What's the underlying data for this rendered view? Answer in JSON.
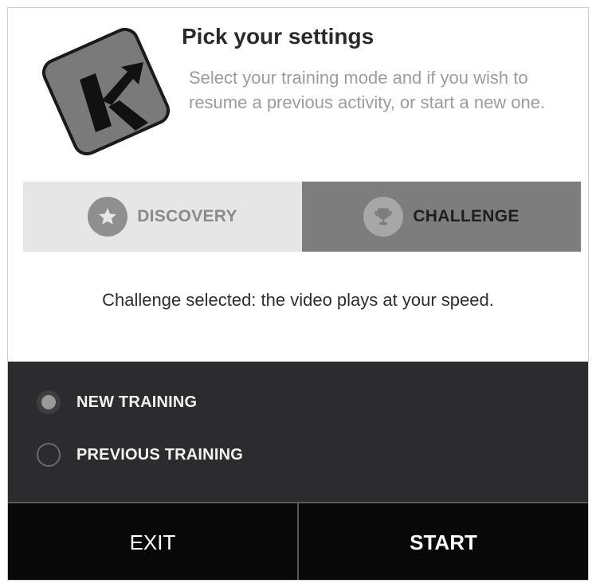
{
  "header": {
    "logo_letter": "K",
    "title": "Pick your settings",
    "subtitle": "Select your training mode and if you wish to resume a previous activity, or start a new one."
  },
  "mode_tabs": [
    {
      "label": "DISCOVERY",
      "icon": "star-icon",
      "selected": false
    },
    {
      "label": "CHALLENGE",
      "icon": "trophy-icon",
      "selected": true
    }
  ],
  "status_text": "Challenge selected: the video plays at your speed.",
  "training_options": [
    {
      "label": "NEW TRAINING",
      "selected": true
    },
    {
      "label": "PREVIOUS TRAINING",
      "selected": false
    }
  ],
  "actions": {
    "exit_label": "EXIT",
    "start_label": "START"
  },
  "colors": {
    "panel_dark": "#2c2c2e",
    "tab_selected": "#7d7d7d",
    "tab_unselected": "#e6e6e6",
    "action_bar": "#080808"
  }
}
